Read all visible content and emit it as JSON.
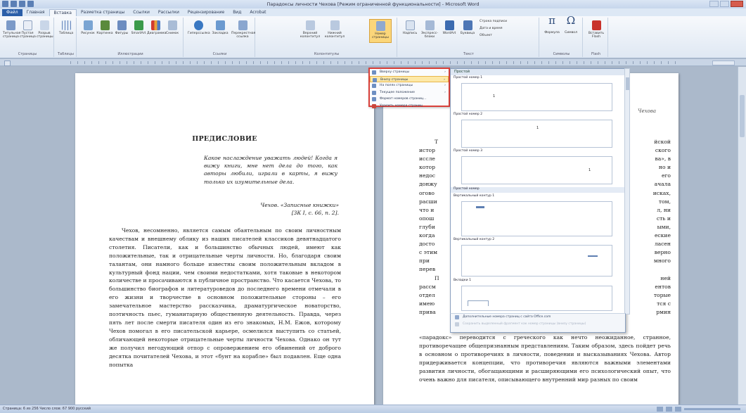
{
  "window": {
    "title": "Парадоксы личности Чехова [Режим ограниченной функциональности] - Microsoft Word"
  },
  "tabs": [
    "Файл",
    "Главная",
    "Вставка",
    "Разметка страницы",
    "Ссылки",
    "Рассылки",
    "Рецензирование",
    "Вид",
    "Acrobat"
  ],
  "ribbon": {
    "groups": [
      {
        "label": "Страницы",
        "buttons": [
          "Титульная страница",
          "Пустая страница",
          "Разрыв страницы"
        ]
      },
      {
        "label": "Таблицы",
        "buttons": [
          "Таблица"
        ]
      },
      {
        "label": "Иллюстрации",
        "buttons": [
          "Рисунок",
          "Картинка",
          "Фигуры",
          "SmartArt",
          "Диаграмма",
          "Снимок"
        ]
      },
      {
        "label": "Ссылки",
        "buttons": [
          "Гиперссылка",
          "Закладка",
          "Перекрестная ссылка"
        ]
      },
      {
        "label": "Колонтитулы",
        "buttons": [
          "Верхний колонтитул",
          "Нижний колонтитул",
          "Номер страницы"
        ]
      },
      {
        "label": "Текст",
        "buttons": [
          "Надпись",
          "Экспресс-блоки",
          "WordArt",
          "Буквица",
          "Строка подписи",
          "Дата и время",
          "Объект"
        ]
      },
      {
        "label": "Символы",
        "buttons": [
          "Формула",
          "Символ"
        ]
      },
      {
        "label": "Flash",
        "buttons": [
          "Вставить Flash"
        ]
      }
    ]
  },
  "page_number_menu": {
    "items": [
      {
        "label": "Вверху страницы",
        "arrow": "›"
      },
      {
        "label": "Внизу страницы",
        "arrow": "›"
      },
      {
        "label": "На полях страницы",
        "arrow": "›"
      },
      {
        "label": "Текущее положение",
        "arrow": "›"
      },
      {
        "label": "Формат номеров страниц...",
        "arrow": ""
      },
      {
        "label": "Удалить номера страниц",
        "arrow": ""
      }
    ]
  },
  "gallery": {
    "header": "Простой",
    "sections": [
      "Простой номер 1",
      "Простой номер 2",
      "Простой номер 3",
      "Простой номер",
      "Вертикальный контур 1",
      "Вертикальный контур 2",
      "Вкладки 1"
    ],
    "footer": [
      "Дополнительные номера страниц с сайта Office.com",
      "Сохранить выделенный фрагмент как номер страницы (внизу страницы)"
    ]
  },
  "page1": {
    "heading": "ПРЕДИСЛОВИЕ",
    "epigraph": "Какое наслаждение уважать людей! Когда я вижу книги, мне нет дела до того, как авторы любили, играли в карты, я вижу только их изумительные дела.",
    "epigraph_src1": "Чехов. «Записные книжки»",
    "epigraph_src2": "[ЗК I, с. 66, п. 2].",
    "body": "Чехов, несомненно, является самым обаятельным по своим личностным качествам и внешнему облику из наших писателей классиков девятнадцатого столетия. Писатели, как и большинство обычных людей, имеют как положительные, так и отрицательные черты личности. Но, благодаря своим талантам, они намного больше известны своим положительным вкладом в культурный фонд нации, чем своими недостатками, хотя таковые в некотором количестве и просачиваются в публичное пространство. Что касается Чехова, то большинство биографов и литературоведов до последнего времени отмечали в его жизни и творчестве в основном положительные стороны – его замечательное мастерство рассказчика, драматургическое новаторство, поэтичность пьес, гуманитарную общественную деятельность. Правда, через пять лет после смерти писателя один из его знакомых, Н.М. Ежов, которому Чехов помогал в его писательской карьере, осмелился выступить со статьей, обличающей некоторые отрицательные черты личности Чехова. Однако он тут же получил негодующий отпор с опровержением его обвинений от доброго десятка почитателей Чехова, и этот «бунт на корабле» был подавлен. Еще одна попытка"
  },
  "page2": {
    "header": "Чехова",
    "left_fragments": [
      "Т",
      "истор",
      "иссле",
      "котор",
      "недос",
      "донжу",
      "огово",
      "расши",
      "что и",
      "опош",
      "глуби",
      "когда",
      "досто",
      "с этим",
      "при",
      "перев",
      "П",
      "рассм",
      "отдел",
      "имею",
      "прива"
    ],
    "right_fragments": [
      "йской",
      "ского",
      "ва», в",
      "но и",
      "его",
      "ачала",
      "исках,",
      "том,",
      "л, ни",
      "сть и",
      "ыми,",
      "еские",
      "ласен",
      "верно",
      "много",
      "",
      "ней",
      "ентов",
      "торые",
      "тся с",
      "рмин"
    ],
    "body": "«парадокс» переводится с греческого как нечто неожиданное, странное, противоречащее общепризнанным представлениям. Таким образом, здесь пойдет речь в основном о противоречиях в личности, поведении и высказываниях Чехова. Автор придерживается концепции, что противоречия являются важными элементами развития личности, обогащающими и расширяющими его психологический опыт, что очень важно для писателя, описывающего внутренний мир разных по своим"
  },
  "status": {
    "left": "Страница: 6 из 256   Число слов: 67 900   русский"
  }
}
